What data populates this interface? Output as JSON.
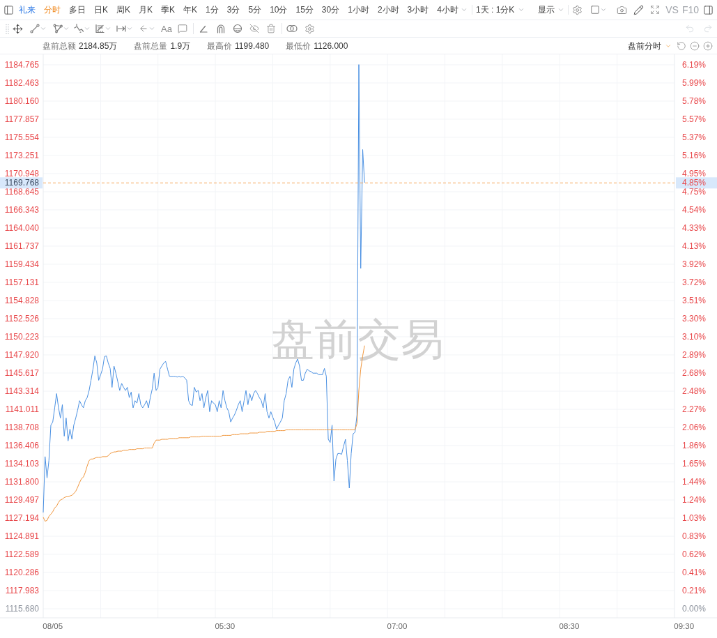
{
  "toolbar": {
    "symbol": "礼来",
    "periods": [
      {
        "label": "分时",
        "selected": true,
        "has_menu": false
      },
      {
        "label": "多日",
        "selected": false,
        "has_menu": false
      },
      {
        "label": "日K",
        "selected": false,
        "has_menu": false
      },
      {
        "label": "周K",
        "selected": false,
        "has_menu": false
      },
      {
        "label": "月K",
        "selected": false,
        "has_menu": false
      },
      {
        "label": "季K",
        "selected": false,
        "has_menu": false
      },
      {
        "label": "年K",
        "selected": false,
        "has_menu": false
      },
      {
        "label": "1分",
        "selected": false,
        "has_menu": false
      },
      {
        "label": "3分",
        "selected": false,
        "has_menu": false
      },
      {
        "label": "5分",
        "selected": false,
        "has_menu": false
      },
      {
        "label": "10分",
        "selected": false,
        "has_menu": false
      },
      {
        "label": "15分",
        "selected": false,
        "has_menu": false
      },
      {
        "label": "30分",
        "selected": false,
        "has_menu": false
      },
      {
        "label": "1小时",
        "selected": false,
        "has_menu": false
      },
      {
        "label": "2小时",
        "selected": false,
        "has_menu": false
      },
      {
        "label": "3小时",
        "selected": false,
        "has_menu": false
      },
      {
        "label": "4小时",
        "selected": false,
        "has_menu": true
      }
    ],
    "range": "1天 : 1分K",
    "display": "显示",
    "compare": "VS",
    "f10": "F10"
  },
  "drawing_toolbar": {
    "text_tool": "Aa",
    "undo": {
      "disabled": true
    },
    "redo": {
      "disabled": true
    }
  },
  "stats": [
    {
      "label": "盘前总额",
      "value": "2184.85万"
    },
    {
      "label": "盘前总量",
      "value": "1.9万"
    },
    {
      "label": "最高价",
      "value": "1199.480"
    },
    {
      "label": "最低价",
      "value": "1126.000"
    }
  ],
  "session_selector": {
    "label": "盘前分时"
  },
  "chart": {
    "watermark": "盘前交易",
    "price_tag": {
      "price": "1169.768",
      "percent": "4.85%"
    },
    "right_axis_labels": [
      {
        "text": "6.19%",
        "base": false
      },
      {
        "text": "5.99%",
        "base": false
      },
      {
        "text": "5.78%",
        "base": false
      },
      {
        "text": "5.57%",
        "base": false
      },
      {
        "text": "5.37%",
        "base": false
      },
      {
        "text": "5.16%",
        "base": false
      },
      {
        "text": "4.95%",
        "base": false
      },
      {
        "text": "4.75%",
        "base": false
      },
      {
        "text": "4.54%",
        "base": false
      },
      {
        "text": "4.33%",
        "base": false
      },
      {
        "text": "4.13%",
        "base": false
      },
      {
        "text": "3.92%",
        "base": false
      },
      {
        "text": "3.72%",
        "base": false
      },
      {
        "text": "3.51%",
        "base": false
      },
      {
        "text": "3.30%",
        "base": false
      },
      {
        "text": "3.10%",
        "base": false
      },
      {
        "text": "2.89%",
        "base": false
      },
      {
        "text": "2.68%",
        "base": false
      },
      {
        "text": "2.48%",
        "base": false
      },
      {
        "text": "2.27%",
        "base": false
      },
      {
        "text": "2.06%",
        "base": false
      },
      {
        "text": "1.86%",
        "base": false
      },
      {
        "text": "1.65%",
        "base": false
      },
      {
        "text": "1.44%",
        "base": false
      },
      {
        "text": "1.24%",
        "base": false
      },
      {
        "text": "1.03%",
        "base": false
      },
      {
        "text": "0.83%",
        "base": false
      },
      {
        "text": "0.62%",
        "base": false
      },
      {
        "text": "0.41%",
        "base": false
      },
      {
        "text": "0.21%",
        "base": false
      },
      {
        "text": "0.00%",
        "base": true
      }
    ],
    "chart_data": {
      "type": "line",
      "grid": true,
      "ylim": [
        1114.529,
        1185.916
      ],
      "categories": [
        null,
        null,
        null,
        null,
        null,
        "08/05",
        null,
        null,
        null,
        null,
        null,
        null,
        null,
        null,
        null,
        null,
        null,
        null,
        null,
        null,
        null,
        null,
        null,
        null,
        null,
        null,
        null,
        null,
        null,
        null,
        null,
        null,
        null,
        null,
        null,
        null,
        null,
        null,
        null,
        null,
        null,
        null,
        null,
        null,
        null,
        null,
        null,
        null,
        null,
        null,
        null,
        null,
        null,
        null,
        null,
        null,
        null,
        null,
        null,
        null,
        null,
        null,
        null,
        null,
        null,
        null,
        null,
        null,
        null,
        null,
        null,
        null,
        null,
        null,
        null,
        null,
        null,
        null,
        null,
        null,
        null,
        null,
        null,
        null,
        null,
        null,
        null,
        null,
        null,
        null,
        null,
        null,
        null,
        null,
        null,
        "05:30",
        null,
        null,
        null,
        null,
        null,
        null,
        null,
        null,
        null,
        null,
        null,
        null,
        null,
        null,
        null,
        null,
        null,
        null,
        null,
        null,
        null,
        null,
        null,
        null,
        null,
        null,
        null,
        null,
        null,
        null,
        null,
        null,
        null,
        null,
        null,
        null,
        null,
        null,
        null,
        null,
        null,
        null,
        null,
        null,
        null,
        null,
        null,
        null,
        null,
        null,
        null,
        null,
        null,
        null,
        null,
        null,
        null,
        null,
        null,
        null,
        null,
        null,
        null,
        null,
        null,
        null,
        null,
        null,
        null,
        null,
        null,
        null,
        null,
        null,
        null,
        null,
        null,
        null,
        null,
        null,
        null,
        null,
        null,
        null,
        null,
        null,
        null,
        null,
        null,
        "07:00",
        null,
        null,
        null,
        null,
        null,
        null,
        null,
        null,
        null,
        null,
        null,
        null,
        null,
        null,
        null,
        null,
        null,
        null,
        null,
        null,
        null,
        null,
        null,
        null,
        null,
        null,
        null,
        null,
        null,
        null,
        null,
        null,
        null,
        null,
        null,
        null,
        null,
        null,
        null,
        null,
        null,
        null,
        null,
        null,
        null,
        null,
        null,
        null,
        null,
        null,
        null,
        null,
        null,
        null,
        null,
        null,
        null,
        null,
        null,
        null,
        null,
        null,
        null,
        null,
        null,
        null,
        null,
        null,
        null,
        null,
        null,
        null,
        null,
        null,
        null,
        null,
        null,
        null,
        null,
        null,
        null,
        null,
        null,
        null,
        null,
        null,
        null,
        null,
        null,
        "08:30",
        null,
        null,
        null,
        null,
        null,
        null,
        null,
        null,
        null,
        null,
        null,
        null,
        null,
        null,
        null,
        null,
        null,
        null,
        null,
        null,
        null,
        null,
        null,
        null,
        null,
        null,
        null,
        null,
        null,
        null,
        null,
        null,
        null,
        null,
        null,
        null,
        null,
        null,
        null,
        null,
        null,
        null,
        null,
        null,
        null,
        null,
        null,
        null,
        null,
        null,
        null,
        null,
        null,
        null,
        null,
        null,
        null,
        null,
        null,
        "09:30"
      ],
      "yticks": [
        {
          "value": 1184.765,
          "label": "1184.765"
        },
        {
          "value": 1182.463,
          "label": "1182.463"
        },
        {
          "value": 1180.16,
          "label": "1180.160"
        },
        {
          "value": 1177.857,
          "label": "1177.857"
        },
        {
          "value": 1175.554,
          "label": "1175.554"
        },
        {
          "value": 1173.251,
          "label": "1173.251"
        },
        {
          "value": 1170.948,
          "label": "1170.948"
        },
        {
          "value": 1168.645,
          "label": "1168.645"
        },
        {
          "value": 1166.343,
          "label": "1166.343"
        },
        {
          "value": 1164.04,
          "label": "1164.040"
        },
        {
          "value": 1161.737,
          "label": "1161.737"
        },
        {
          "value": 1159.434,
          "label": "1159.434"
        },
        {
          "value": 1157.131,
          "label": "1157.131"
        },
        {
          "value": 1154.828,
          "label": "1154.828"
        },
        {
          "value": 1152.526,
          "label": "1152.526"
        },
        {
          "value": 1150.223,
          "label": "1150.223"
        },
        {
          "value": 1147.92,
          "label": "1147.920"
        },
        {
          "value": 1145.617,
          "label": "1145.617"
        },
        {
          "value": 1143.314,
          "label": "1143.314"
        },
        {
          "value": 1141.011,
          "label": "1141.011"
        },
        {
          "value": 1138.708,
          "label": "1138.708"
        },
        {
          "value": 1136.406,
          "label": "1136.406"
        },
        {
          "value": 1134.103,
          "label": "1134.103"
        },
        {
          "value": 1131.8,
          "label": "1131.800"
        },
        {
          "value": 1129.497,
          "label": "1129.497"
        },
        {
          "value": 1127.194,
          "label": "1127.194"
        },
        {
          "value": 1124.891,
          "label": "1124.891"
        },
        {
          "value": 1122.589,
          "label": "1122.589"
        },
        {
          "value": 1120.286,
          "label": "1120.286"
        },
        {
          "value": 1117.983,
          "label": "1117.983"
        },
        {
          "value": 1115.68,
          "label": "1115.680"
        }
      ],
      "series": [
        {
          "color": "#4a90e2",
          "values": [
            1127.9,
            1135.0,
            1132.3,
            1134.5,
            1139.0,
            1139.4,
            1141.2,
            1143.0,
            1141.2,
            1139.9,
            1141.6,
            1137.6,
            1139.9,
            1137.0,
            1138.5,
            1137.2,
            1139.0,
            1139.9,
            1140.9,
            1142.1,
            1141.6,
            1141.2,
            1142.1,
            1142.5,
            1143.4,
            1144.7,
            1146.1,
            1147.8,
            1146.9,
            1144.7,
            1145.4,
            1146.1,
            1147.7,
            1147.8,
            1146.9,
            1146.2,
            1143.8,
            1146.5,
            1145.6,
            1144.5,
            1143.4,
            1144.3,
            1143.8,
            1143.4,
            1143.8,
            1142.5,
            1143.2,
            1141.2,
            1142.1,
            1141.8,
            1143.0,
            1141.6,
            1141.2,
            1141.6,
            1142.1,
            1141.2,
            1142.5,
            1143.6,
            1145.6,
            1143.4,
            1143.8,
            1146.1,
            1146.5,
            1146.9,
            1147.1,
            1146.1,
            1145.2,
            1145.2,
            1145.2,
            1145.2,
            1145.1,
            1145.2,
            1145.1,
            1145.2,
            1145.0,
            1144.7,
            1142.1,
            1141.6,
            1141.5,
            1143.8,
            1143.2,
            1143.4,
            1142.1,
            1143.0,
            1141.2,
            1142.5,
            1143.4,
            1140.7,
            1142.1,
            1141.8,
            1141.6,
            1140.7,
            1142.1,
            1141.2,
            1143.4,
            1142.1,
            1141.2,
            1140.7,
            1139.4,
            1139.9,
            1140.3,
            1140.9,
            1141.6,
            1142.1,
            1140.7,
            1142.1,
            1143.4,
            1141.6,
            1143.0,
            1142.1,
            1143.0,
            1143.4,
            1143.0,
            1142.5,
            1142.1,
            1141.2,
            1143.0,
            1140.7,
            1139.9,
            1140.7,
            1140.0,
            1139.4,
            1138.5,
            1139.0,
            1139.4,
            1139.9,
            1142.1,
            1143.0,
            1144.7,
            1145.2,
            1143.8,
            1146.1,
            1146.9,
            1147.4,
            1146.5,
            1144.7,
            1144.7,
            1145.6,
            1146.1,
            1145.9,
            1145.8,
            1145.6,
            1145.6,
            1145.6,
            1145.4,
            1145.4,
            1145.4,
            1146.2,
            1145.2,
            1137.2,
            1136.8,
            1139.0,
            1131.9,
            1134.7,
            1135.4,
            1135.4,
            1135.3,
            1136.3,
            1137.2,
            1134.5,
            1131.0,
            1135.4,
            1137.9,
            1138.1,
            1140.3,
            1184.8,
            1158.9,
            1174.0,
            1169.8,
            null,
            null,
            null,
            null,
            null,
            null,
            null,
            null,
            null,
            null,
            null,
            null,
            null,
            null,
            null,
            null,
            null,
            null,
            null,
            null,
            null,
            null,
            null,
            null,
            null,
            null,
            null,
            null,
            null,
            null,
            null,
            null,
            null,
            null,
            null,
            null,
            null,
            null,
            null,
            null,
            null,
            null,
            null,
            null,
            null,
            null,
            null,
            null,
            null,
            null,
            null,
            null,
            null,
            null,
            null,
            null,
            null,
            null,
            null,
            null,
            null,
            null,
            null,
            null,
            null,
            null,
            null,
            null,
            null,
            null,
            null,
            null,
            null,
            null,
            null,
            null,
            null,
            null,
            null,
            null,
            null,
            null,
            null,
            null,
            null,
            null,
            null,
            null,
            null,
            null,
            null,
            null,
            null,
            null,
            null,
            null,
            null,
            null,
            null,
            null,
            null,
            null,
            null,
            null,
            null,
            null,
            null,
            null,
            null,
            null,
            null,
            null,
            null,
            null,
            null,
            null,
            null,
            null,
            null,
            null,
            null,
            null,
            null,
            null,
            null,
            null,
            null,
            null,
            null,
            null,
            null,
            null,
            null,
            null,
            null,
            null,
            null,
            null,
            null,
            null,
            null,
            null,
            null,
            null,
            null,
            null,
            null,
            null,
            null,
            null,
            null,
            null,
            null,
            null,
            null,
            null,
            null,
            null,
            null,
            null,
            null,
            null,
            null,
            null,
            null,
            null,
            null
          ]
        },
        {
          "color": "#f0963c",
          "values": [
            1127.3,
            1126.8,
            1126.9,
            1127.4,
            1127.7,
            1128.0,
            1128.5,
            1128.7,
            1129.2,
            1129.5,
            1129.6,
            1129.8,
            1129.9,
            1129.9,
            1130.0,
            1130.1,
            1130.3,
            1130.6,
            1131.1,
            1131.7,
            1132.2,
            1132.4,
            1133.0,
            1133.8,
            1134.5,
            1134.7,
            1134.7,
            1134.8,
            1134.9,
            1134.9,
            1134.9,
            1135.0,
            1135.0,
            1135.0,
            1135.1,
            1135.4,
            1135.5,
            1135.6,
            1135.6,
            1135.7,
            1135.7,
            1135.7,
            1135.8,
            1135.8,
            1135.8,
            1135.9,
            1135.9,
            1135.9,
            1135.9,
            1136.0,
            1136.0,
            1136.0,
            1136.0,
            1136.1,
            1136.1,
            1136.1,
            1136.1,
            1136.1,
            1136.7,
            1137.1,
            1137.1,
            1137.1,
            1137.2,
            1137.2,
            1137.2,
            1137.2,
            1137.3,
            1137.3,
            1137.3,
            1137.3,
            1137.3,
            1137.4,
            1137.4,
            1137.4,
            1137.4,
            1137.4,
            1137.4,
            1137.5,
            1137.5,
            1137.5,
            1137.5,
            1137.5,
            1137.5,
            1137.6,
            1137.6,
            1137.6,
            1137.6,
            1137.6,
            1137.6,
            1137.6,
            1137.6,
            1137.6,
            1137.6,
            1137.6,
            1137.7,
            1137.7,
            1137.7,
            1137.7,
            1137.7,
            1137.8,
            1137.8,
            1137.8,
            1137.8,
            1137.9,
            1137.9,
            1137.9,
            1137.9,
            1137.9,
            1138.0,
            1138.0,
            1138.0,
            1138.0,
            1138.0,
            1138.1,
            1138.1,
            1138.1,
            1138.1,
            1138.2,
            1138.2,
            1138.2,
            1138.2,
            1138.2,
            1138.3,
            1138.3,
            1138.3,
            1138.3,
            1138.3,
            1138.4,
            1138.4,
            1138.4,
            1138.4,
            1138.4,
            1138.4,
            1138.4,
            1138.4,
            1138.4,
            1138.4,
            1138.4,
            1138.4,
            1138.4,
            1138.4,
            1138.4,
            1138.4,
            1138.4,
            1138.4,
            1138.4,
            1138.4,
            1138.4,
            1138.4,
            1138.4,
            1138.4,
            1138.4,
            1138.4,
            1138.4,
            1138.4,
            1138.4,
            1138.4,
            1138.4,
            1138.4,
            1138.4,
            1138.4,
            1138.4,
            1138.4,
            1138.4,
            1139.2,
            1143.4,
            1146.1,
            1147.8,
            1149.1,
            null,
            null,
            null,
            null,
            null,
            null,
            null,
            null,
            null,
            null,
            null,
            null,
            null,
            null,
            null,
            null,
            null,
            null,
            null,
            null,
            null,
            null,
            null,
            null,
            null,
            null,
            null,
            null,
            null,
            null,
            null,
            null,
            null,
            null,
            null,
            null,
            null,
            null,
            null,
            null,
            null,
            null,
            null,
            null,
            null,
            null,
            null,
            null,
            null,
            null,
            null,
            null,
            null,
            null,
            null,
            null,
            null,
            null,
            null,
            null,
            null,
            null,
            null,
            null,
            null,
            null,
            null,
            null,
            null,
            null,
            null,
            null,
            null,
            null,
            null,
            null,
            null,
            null,
            null,
            null,
            null,
            null,
            null,
            null,
            null,
            null,
            null,
            null,
            null,
            null,
            null,
            null,
            null,
            null,
            null,
            null,
            null,
            null,
            null,
            null,
            null,
            null,
            null,
            null,
            null,
            null,
            null,
            null,
            null,
            null,
            null,
            null,
            null,
            null,
            null,
            null,
            null,
            null,
            null,
            null,
            null,
            null,
            null,
            null,
            null,
            null,
            null,
            null,
            null,
            null,
            null,
            null,
            null,
            null,
            null,
            null,
            null,
            null,
            null,
            null,
            null,
            null,
            null,
            null,
            null,
            null,
            null,
            null,
            null,
            null,
            null,
            null,
            null,
            null,
            null,
            null,
            null,
            null,
            null,
            null,
            null,
            null,
            null,
            null,
            null,
            null,
            null
          ]
        }
      ],
      "ref_lines": [
        {
          "axis": "y",
          "value": 1169.768
        }
      ]
    }
  }
}
